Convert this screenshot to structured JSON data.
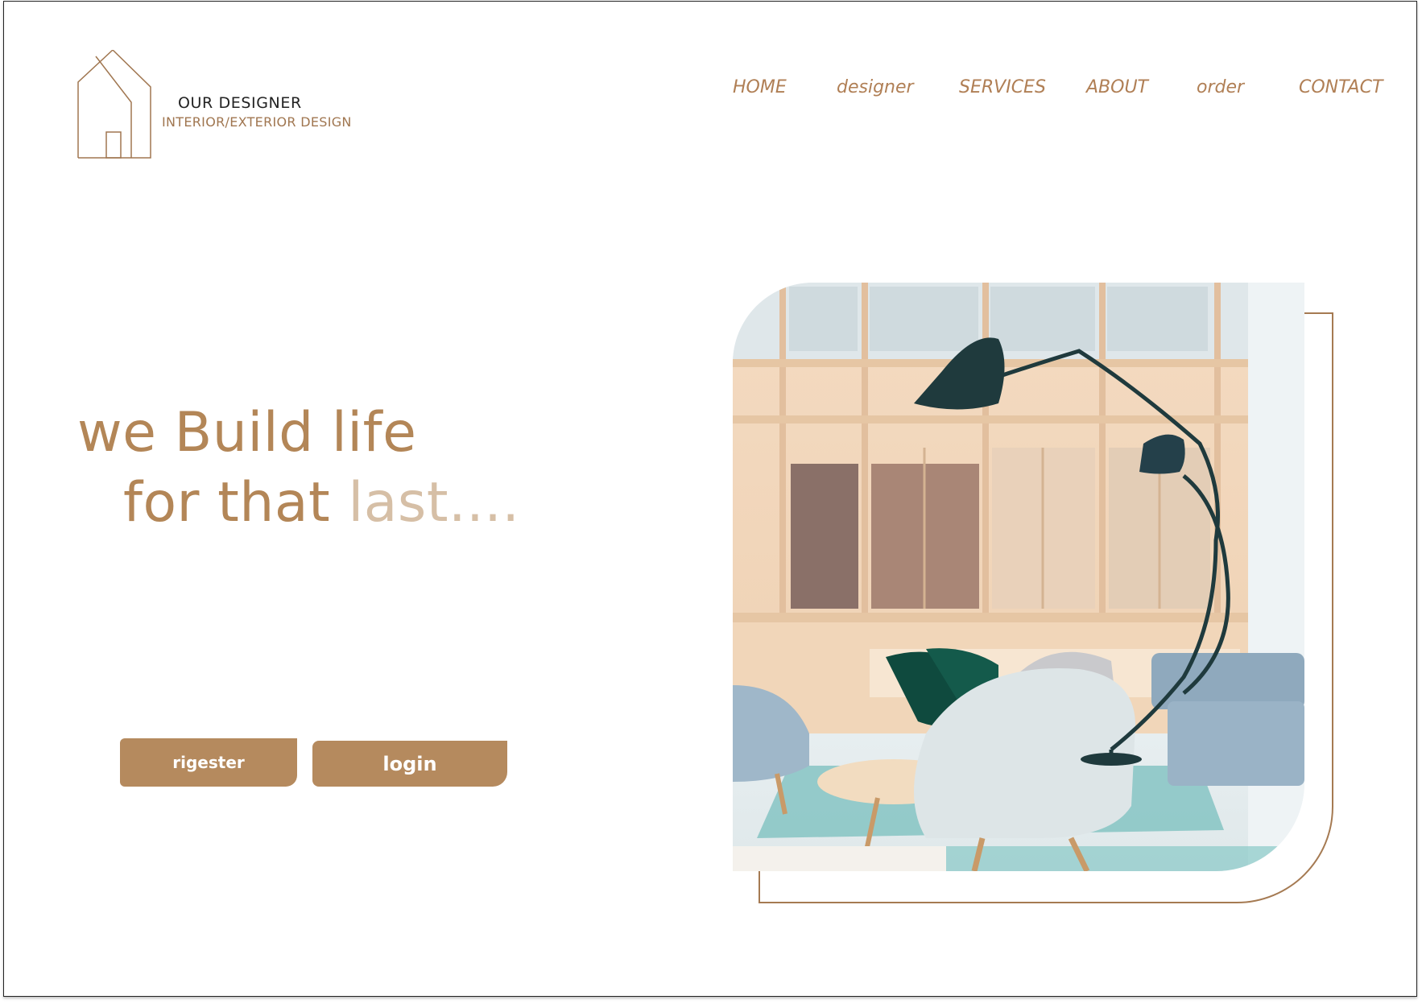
{
  "brand": {
    "title": "OUR DESIGNER",
    "subtitle": "INTERIOR/EXTERIOR DESIGN",
    "logo_icon": "house-outline-icon"
  },
  "nav": {
    "items": [
      {
        "label": "HOME"
      },
      {
        "label": "designer"
      },
      {
        "label": "SERVICES"
      },
      {
        "label": "ABOUT"
      },
      {
        "label": "order"
      },
      {
        "label": "CONTACT"
      }
    ]
  },
  "hero": {
    "line1": "we Build life",
    "line2_main": "for that ",
    "line2_accent": "last...."
  },
  "buttons": {
    "register": "rigester",
    "login": "login"
  },
  "colors": {
    "accent": "#b38657",
    "accent_light": "#d6bfa6",
    "button": "#b58a5e",
    "nav": "#b07f55",
    "outline": "#a57a52"
  }
}
